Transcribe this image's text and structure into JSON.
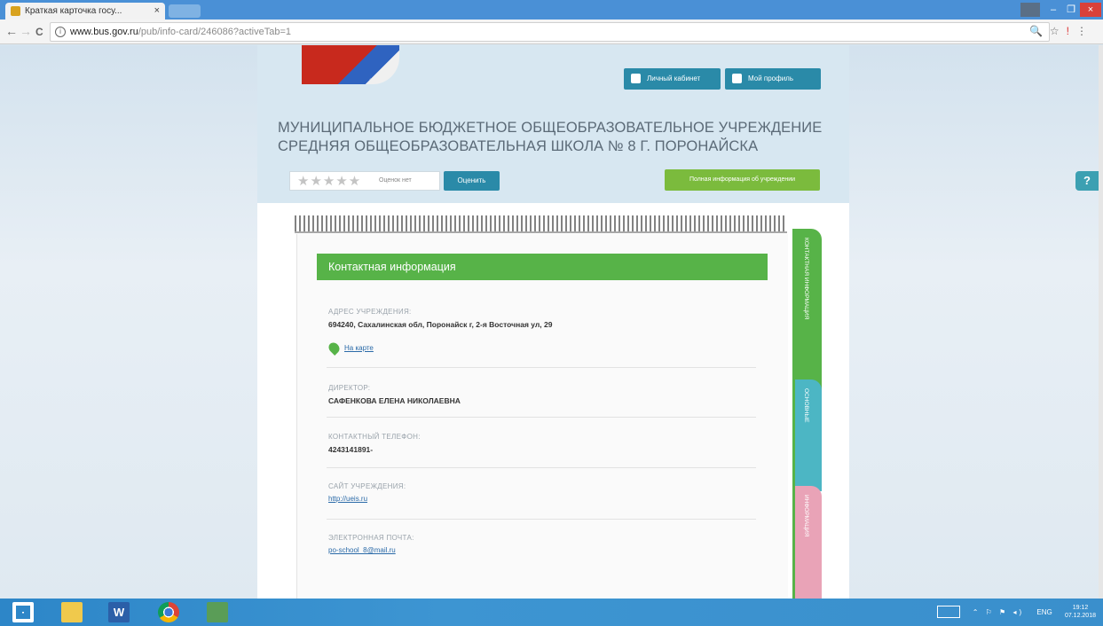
{
  "browser": {
    "tab_title": "Краткая карточка госу...",
    "tab_close": "×",
    "url_domain": "www.bus.gov.ru",
    "url_path": "/pub/info-card/246086?activeTab=1",
    "back": "←",
    "forward": "→",
    "reload": "C",
    "info": "i",
    "right_icons": {
      "zoom": "🔍",
      "star": "☆"
    },
    "window_controls": {
      "minimize": "–",
      "maximize": "❐",
      "close": "×"
    }
  },
  "header": {
    "cabinet_button": "Личный кабинет",
    "profile_button": "Мой профиль",
    "org_title": "МУНИЦИПАЛЬНОЕ БЮДЖЕТНОЕ ОБЩЕОБРАЗОВАТЕЛЬНОЕ УЧРЕЖДЕНИЕ СРЕДНЯЯ ОБЩЕОБРАЗОВАТЕЛЬНАЯ ШКОЛА № 8 Г. ПОРОНАЙСКА",
    "stars": "★★★★★",
    "rating_text": "Оценок нет",
    "rate_button": "Оценить",
    "full_info_button": "Полная информация об учреждении"
  },
  "contact": {
    "section_title": "Контактная информация",
    "address_label": "АДРЕС УЧРЕЖДЕНИЯ:",
    "address_value": "694240, Сахалинская обл, Поронайск г, 2-я Восточная ул, 29",
    "map_link": "На карте",
    "director_label": "ДИРЕКТОР:",
    "director_value": "САФЕНКОВА ЕЛЕНА НИКОЛАЕВНА",
    "phone_label": "КОНТАКТНЫЙ ТЕЛЕФОН:",
    "phone_value": "4243141891-",
    "site_label": "САЙТ УЧРЕЖДЕНИЯ:",
    "site_value": "http://ueis.ru",
    "email_label": "ЭЛЕКТРОННАЯ ПОЧТА:",
    "email_value": "po-school_8@mail.ru"
  },
  "side_tabs": {
    "green": "КОНТАКТНАЯ ИНФОРМАЦИЯ",
    "teal": "ОСНОВНЫЕ",
    "pink": "ИНФОРМАЦИЯ"
  },
  "help": "?",
  "taskbar": {
    "word": "W",
    "lang": "ENG",
    "time": "19:12",
    "date": "07.12.2018"
  }
}
